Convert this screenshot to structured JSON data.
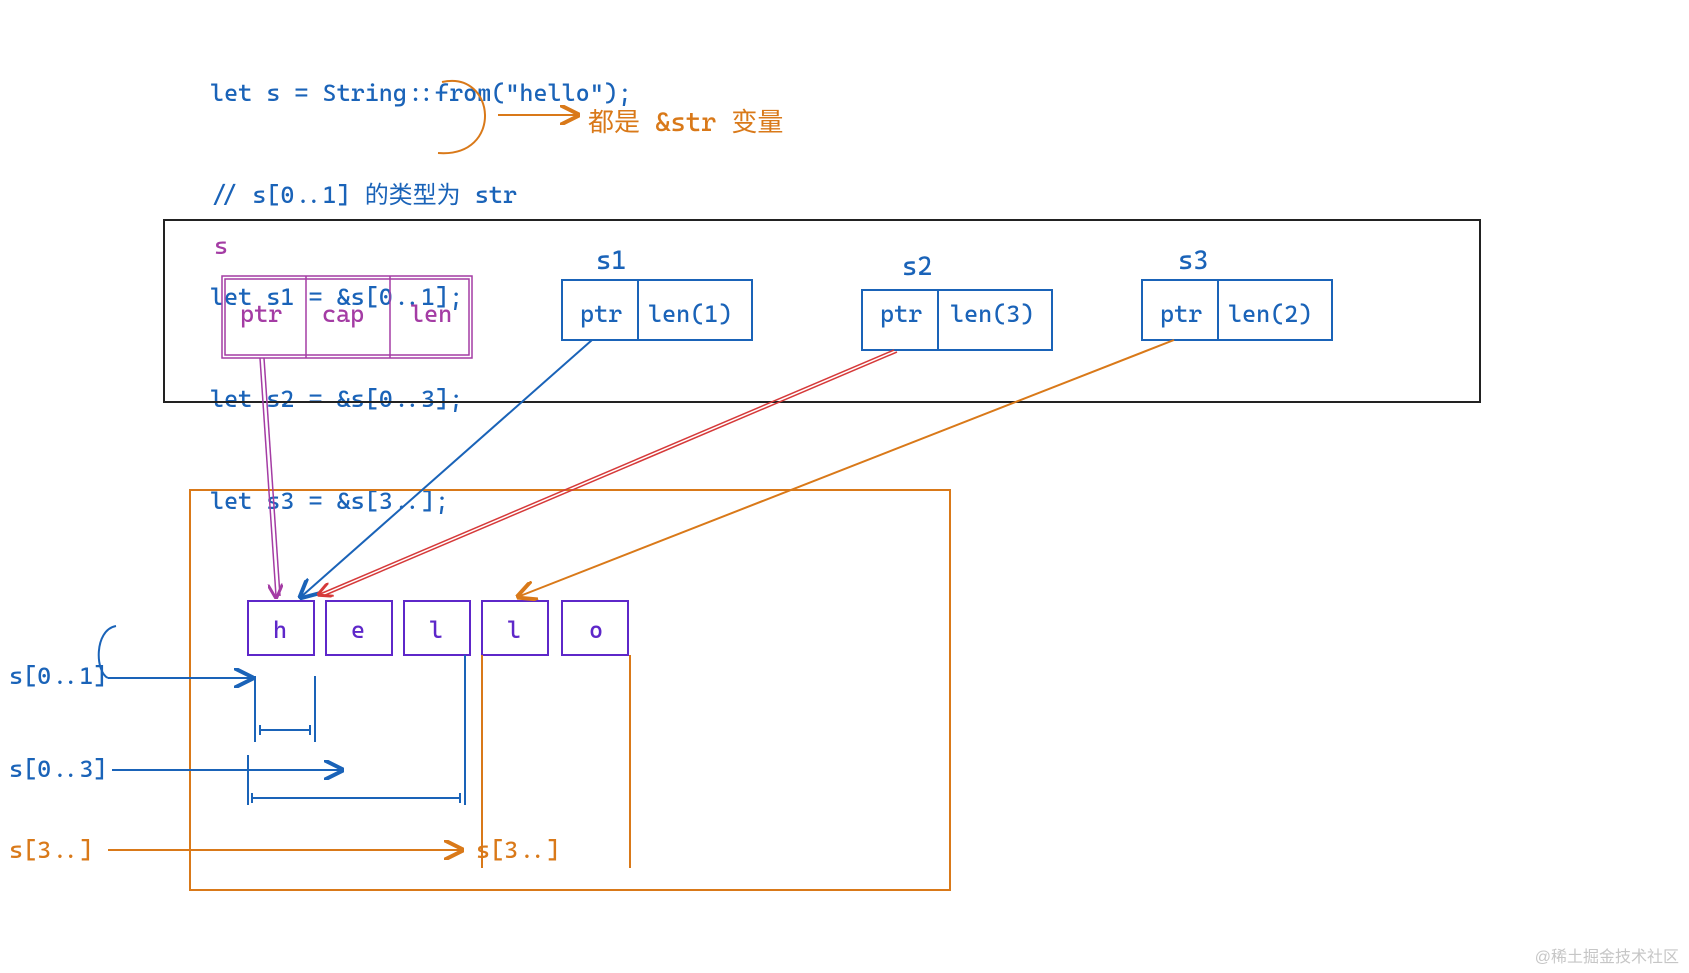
{
  "code": {
    "l1": "let s = String::from(\"hello\");",
    "l2": "// s[0..1] 的类型为 str",
    "l3": "let s1 = &s[0..1];",
    "l4": "let s2 = &s[0..3];",
    "l5": "let s3 = &s[3..];"
  },
  "annotation": "都是 &str 变量",
  "stack": {
    "s": {
      "name": "s",
      "fields": [
        "ptr",
        "cap",
        "len"
      ]
    },
    "s1": {
      "name": "s1",
      "fields": [
        "ptr",
        "len(1)"
      ]
    },
    "s2": {
      "name": "s2",
      "fields": [
        "ptr",
        "len(3)"
      ]
    },
    "s3": {
      "name": "s3",
      "fields": [
        "ptr",
        "len(2)"
      ]
    }
  },
  "heap": {
    "chars": [
      "h",
      "e",
      "l",
      "l",
      "o"
    ]
  },
  "slice_labels": {
    "a": "s[0..1]",
    "b": "s[0..3]",
    "c_left": "s[3..]",
    "c_right": "s[3..]"
  },
  "watermark": "@稀土掘金技术社区",
  "colors": {
    "blue": "#1a63b8",
    "orange": "#d97919",
    "purple": "#a43ca4",
    "indigo": "#5e27c9",
    "red": "#d63a3a",
    "black": "#222222"
  }
}
